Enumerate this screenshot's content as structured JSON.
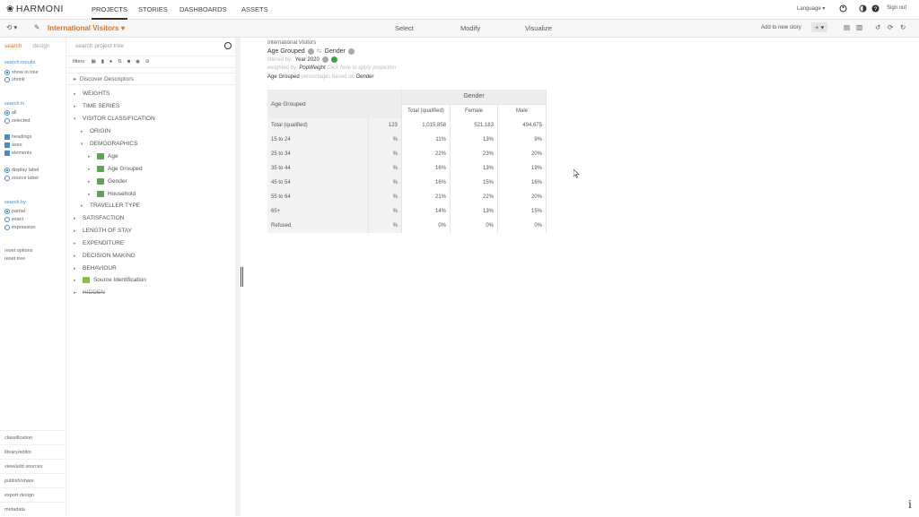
{
  "app": {
    "logo": "HARMONI"
  },
  "nav": {
    "projects": "PROJECTS",
    "stories": "STORIES",
    "dashboards": "DASHBOARDS",
    "assets": "ASSETS"
  },
  "topright": {
    "language": "Language ▾",
    "signout": "Sign out"
  },
  "toolbar": {
    "story_title": "International Visitors",
    "select": "Select",
    "modify": "Modify",
    "visualize": "Visualize",
    "add_story": "Add to new story"
  },
  "leftrail": {
    "tab_search": "search",
    "tab_design": "design",
    "search_results": "search results",
    "show_in_tree": "show in tree",
    "shrink": "shrink",
    "search_in": "search in",
    "all": "all",
    "selected": "selected",
    "headings": "headings",
    "axes": "axes",
    "elements": "elements",
    "display_label": "display label",
    "source_label": "source label",
    "search_by": "search by",
    "partial": "partial",
    "exact": "exact",
    "expression": "expression",
    "reset_options": "reset options",
    "reset_tree": "reset tree",
    "bottom": [
      "classification",
      "library/editor",
      "view/add sources",
      "publish/share",
      "export design",
      "metadata"
    ]
  },
  "tree": {
    "search_placeholder": "search project tree",
    "filters": "filters:",
    "discover": "Discover Descriptors",
    "rows": [
      "WEIGHTS",
      "TIME SERIES",
      "VISITOR CLASSIFICATION",
      "ORIGIN",
      "DEMOGRAPHICS",
      "Age",
      "Age Grouped",
      "Gender",
      "Household",
      "TRAVELLER TYPE",
      "SATISFACTION",
      "LENGTH OF STAY",
      "EXPENDITURE",
      "DECISION MAKING",
      "BEHAVIOUR",
      "Source Identification",
      "HIDDEN"
    ]
  },
  "main": {
    "title": "International Visitors",
    "row_var": "Age Grouped",
    "col_var": "Gender",
    "filter_label": "filtered by:",
    "filter_value": "Year 2020",
    "weight_label": "weighted by:",
    "weight_value": "PopWeight",
    "weight_hint": "Click here to apply projection",
    "pct_base_var": "Age Grouped",
    "pct_mid": "percentages based on",
    "pct_base_col": "Gender"
  },
  "table": {
    "corner": "Age Grouped",
    "header": "Gender",
    "cols": [
      "Total (qualified)",
      "Female",
      "Male"
    ],
    "rows": [
      {
        "label": "Total (qualified)",
        "unit": "123",
        "v": [
          "1,015,858",
          "521,183",
          "494,675"
        ]
      },
      {
        "label": "15 to 24",
        "unit": "%",
        "v": [
          "11%",
          "13%",
          "9%"
        ]
      },
      {
        "label": "25 to 34",
        "unit": "%",
        "v": [
          "22%",
          "23%",
          "20%"
        ]
      },
      {
        "label": "35 to 44",
        "unit": "%",
        "v": [
          "16%",
          "13%",
          "19%"
        ]
      },
      {
        "label": "45 to 54",
        "unit": "%",
        "v": [
          "16%",
          "15%",
          "16%"
        ]
      },
      {
        "label": "55 to 64",
        "unit": "%",
        "v": [
          "21%",
          "22%",
          "20%"
        ]
      },
      {
        "label": "65+",
        "unit": "%",
        "v": [
          "14%",
          "13%",
          "15%"
        ]
      },
      {
        "label": "Refused",
        "unit": "%",
        "v": [
          "0%",
          "0%",
          "0%"
        ]
      }
    ]
  }
}
